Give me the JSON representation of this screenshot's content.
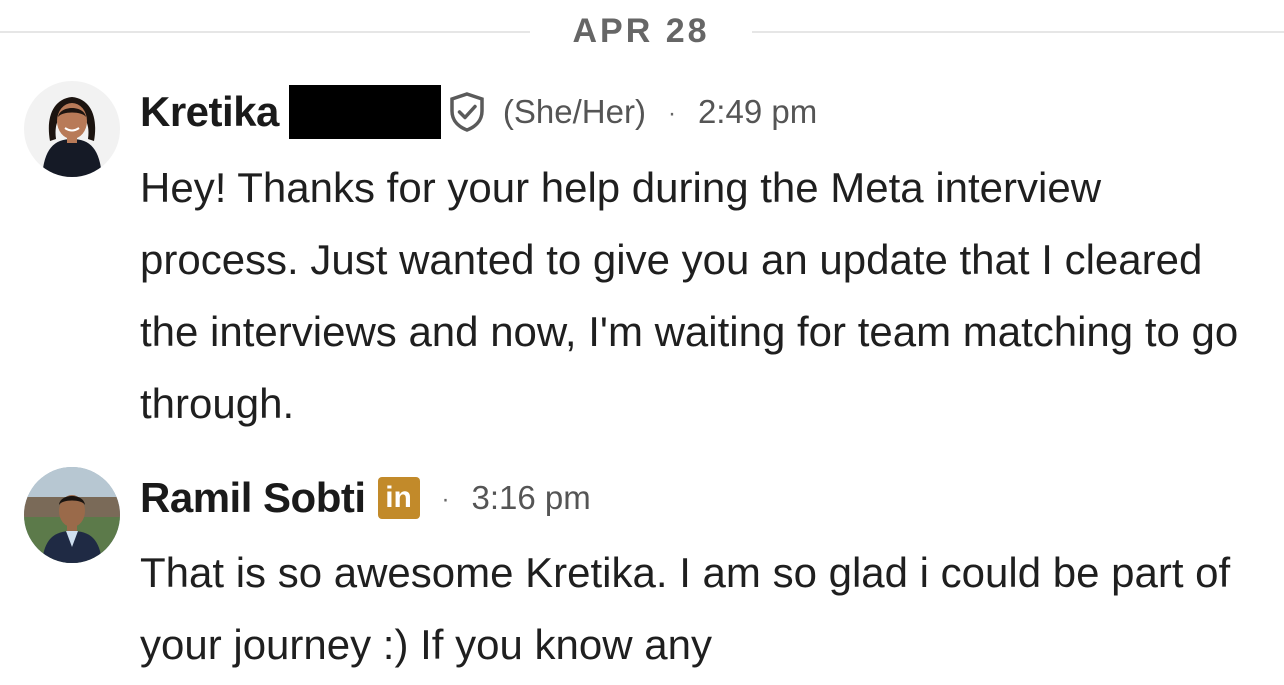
{
  "date_divider": "APR 28",
  "messages": [
    {
      "sender": "Kretika",
      "pronouns": "(She/Her)",
      "separator": "·",
      "time": "2:49 pm",
      "text": "Hey! Thanks for your help during the Meta interview process. Just wanted to give you an update that I cleared the interviews and now, I'm waiting for team matching to go through."
    },
    {
      "sender": "Ramil Sobti",
      "badge": "in",
      "separator": "·",
      "time": "3:16 pm",
      "text": "That is so awesome Kretika. I am so glad i could be part of your journey :)  If you know any"
    }
  ],
  "colors": {
    "linkedin_badge": "#c28a2a",
    "divider": "#e6e6e6"
  }
}
